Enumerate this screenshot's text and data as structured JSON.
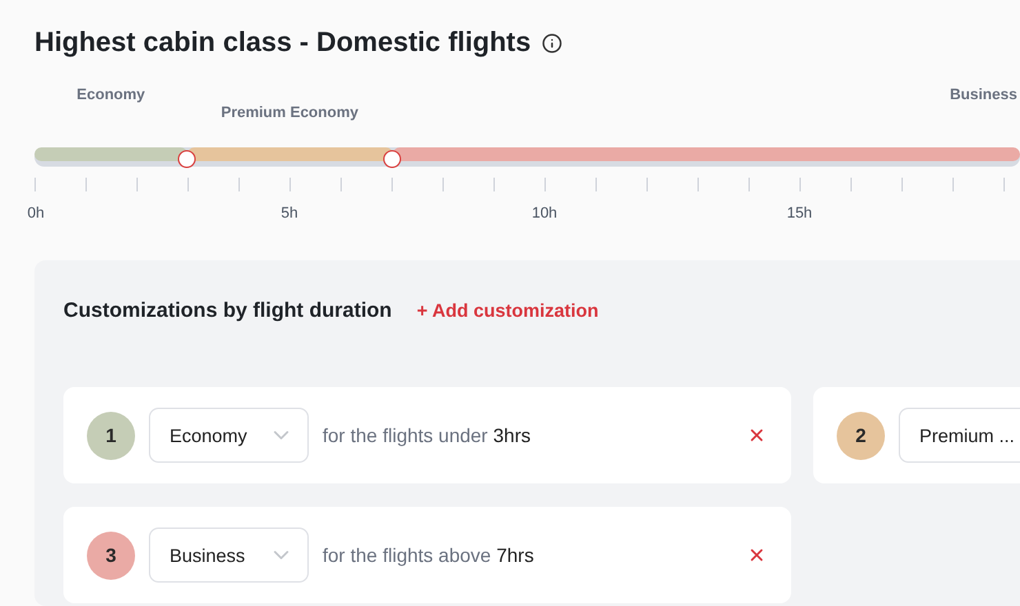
{
  "title": "Highest cabin class - Domestic flights",
  "timeline": {
    "segments": [
      {
        "label": "Economy",
        "color": "#c5cdb6"
      },
      {
        "label": "Premium Economy",
        "color": "#e6c49c"
      },
      {
        "label": "Business",
        "color": "#eaaaa5"
      }
    ],
    "handles": [
      {
        "level": 0.155
      },
      {
        "level": 0.363
      }
    ],
    "tick_labels": [
      "0h",
      "5h",
      "10h",
      "15h"
    ]
  },
  "customizations": {
    "title": "Customizations by flight duration",
    "add_button": "+ Add customization",
    "cards": [
      {
        "number": "1",
        "color": "#c5cdb6",
        "cabin": "Economy",
        "condition": "for the flights under",
        "value": "3hrs",
        "removable": true
      },
      {
        "number": "2",
        "color": "#e6c49c",
        "cabin": "Premium ..."
      },
      {
        "number": "3",
        "color": "#eaaaa5",
        "cabin": "Business",
        "condition": "for the flights above",
        "value": "7hrs",
        "removable": true
      }
    ]
  }
}
